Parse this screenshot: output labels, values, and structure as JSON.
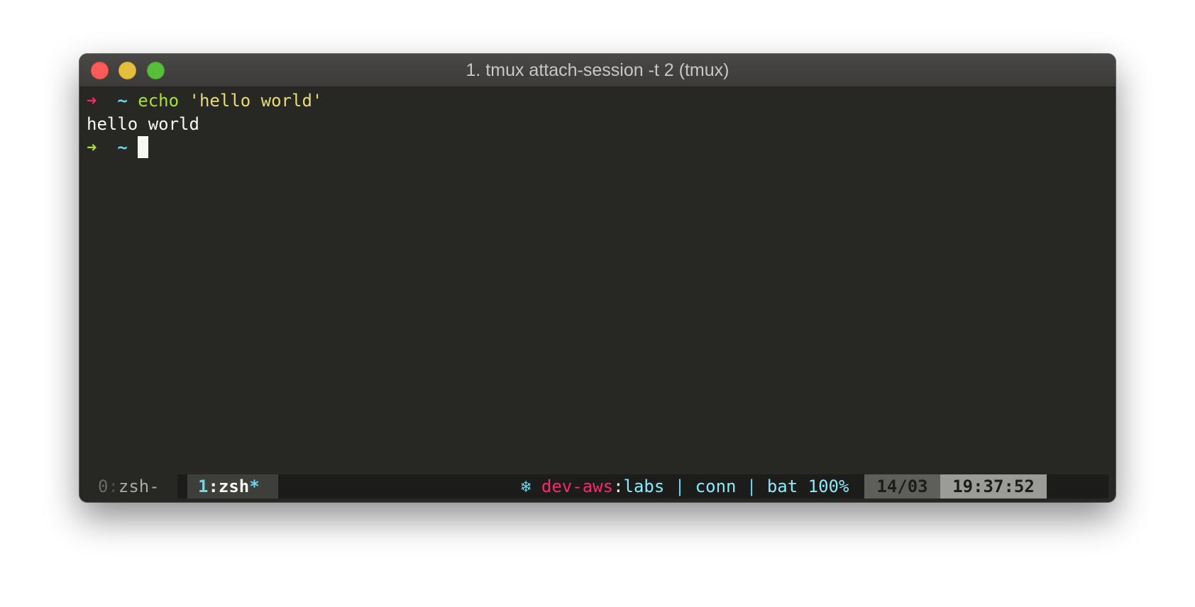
{
  "window": {
    "title": "1. tmux attach-session -t 2 (tmux)",
    "traffic_lights": {
      "close": {
        "icon": "close-icon",
        "color": "#fc5b57"
      },
      "minimize": {
        "icon": "minimize-icon",
        "color": "#e5bf3c"
      },
      "zoom": {
        "icon": "zoom-icon",
        "color": "#57c038"
      }
    }
  },
  "terminal": {
    "lines": [
      {
        "prompt_arrow": "➜",
        "prompt_dir": "~",
        "command": "echo",
        "argument": "'hello world'"
      },
      {
        "output": "hello world"
      },
      {
        "prompt_arrow": "➜",
        "prompt_dir": "~"
      }
    ],
    "colors": {
      "background": "#272824",
      "prompt_arrow_error": "#f92672",
      "prompt_arrow_ok": "#a6e22e",
      "prompt_dir": "#66d9ef",
      "command": "#a6e22e",
      "string": "#e6db74",
      "foreground": "#f8f8f2"
    }
  },
  "statusbar": {
    "windows": [
      {
        "index": "0",
        "separator": ":",
        "name": "zsh",
        "flag": "-"
      },
      {
        "index": "1",
        "separator": ":",
        "name": "zsh",
        "flag": "*"
      }
    ],
    "kube_icon": "❄",
    "kube_context": "dev-aws",
    "kube_separator": ":",
    "kube_namespace": "labs",
    "divider": "|",
    "connection": "conn",
    "battery": "bat 100%",
    "date": "14/03",
    "time": "19:37:52"
  }
}
